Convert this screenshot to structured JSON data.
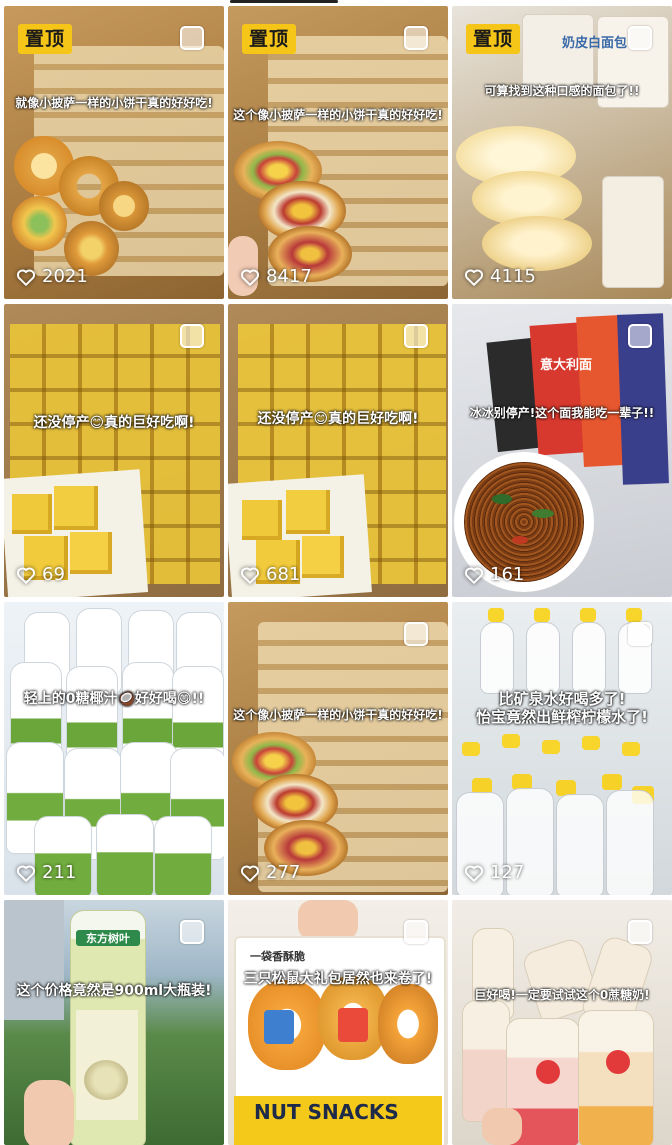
{
  "pinned_label": "置顶",
  "tiles": [
    {
      "caption": "就像小披萨一样的小饼干真的好好吃!",
      "likes": "2021",
      "pinned": true
    },
    {
      "caption": "这个像小披萨一样的小饼干真的好好吃!",
      "likes": "8417",
      "pinned": true
    },
    {
      "caption": "可算找到这种口感的面包了!!",
      "likes": "4115",
      "pinned": true,
      "product_text": "奶皮白面包"
    },
    {
      "caption": "还没停产😊真的巨好吃啊!",
      "likes": "69",
      "pinned": false
    },
    {
      "caption": "还没停产😊真的巨好吃啊!",
      "likes": "681",
      "pinned": false
    },
    {
      "caption": "冰冰别停产!这个面我能吃一辈子!!",
      "likes": "161",
      "pinned": false,
      "product_text": "意大利面"
    },
    {
      "caption": "轻上的0糖椰汁🥥好好喝😋!!",
      "likes": "211",
      "pinned": false
    },
    {
      "caption": "这个像小披萨一样的小饼干真的好好吃!",
      "likes": "277",
      "pinned": false
    },
    {
      "caption": "比矿泉水好喝多了!",
      "caption2": "怡宝竟然出鲜榨柠檬水了!",
      "likes": "127",
      "pinned": false
    },
    {
      "caption": "这个价格竟然是900ml大瓶装!",
      "likes": "",
      "pinned": false,
      "product_text": "东方树叶"
    },
    {
      "caption": "三只松鼠大礼包居然也来卷了!",
      "likes": "",
      "pinned": false,
      "product_text": "NUT SNACKS",
      "product_text2": "一袋香酥脆"
    },
    {
      "caption": "巨好喝!一定要试试这个0蔗糖奶!",
      "likes": "",
      "pinned": false
    }
  ],
  "colors": {
    "pin_bg": "#f5c518",
    "like_text": "#ffffff",
    "background": "#ffffff"
  },
  "icons": {
    "like": "heart-outline-icon",
    "select": "select-checkbox-icon"
  }
}
